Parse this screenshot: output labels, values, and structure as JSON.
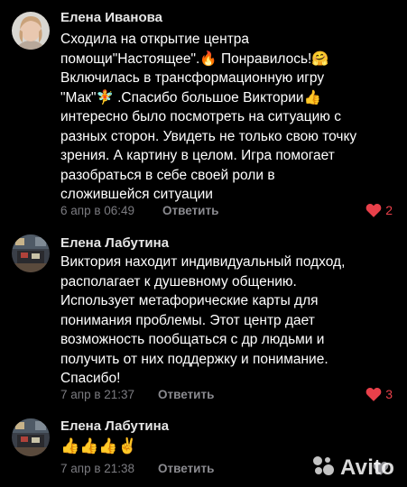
{
  "comments": [
    {
      "author": "Елена Иванова",
      "text": "Сходила на открытие центра\nпомощи\"Настоящее\".🔥 Понравилось!🤗\nВключилась в трансформационную игру\n\"Мак\"🧚 .Спасибо большое Виктории👍\nинтересно было посмотреть на ситуацию с\nразных сторон. Увидеть не только свою точку\nзрения. А картину в целом. Игра помогает\nразобраться в себе своей роли в\nсложившейся ситуации",
      "timestamp": "6 апр в 06:49",
      "reply_label": "Ответить",
      "likes": "2",
      "avatar_icon": "woman-portrait-avatar"
    },
    {
      "author": "Елена Лабутина",
      "text": "Виктория находит индивидуальный подход,\nрасполагает к душевному общению.\nИспользует метафорические карты для\nпонимания проблемы. Этот центр дает\nвозможность пообщаться с др людьми и\nполучить от них поддержку и понимание.\nСпасибо!",
      "timestamp": "7 апр в 21:37",
      "reply_label": "Ответить",
      "likes": "3",
      "avatar_icon": "room-photo-avatar"
    },
    {
      "author": "Елена Лабутина",
      "text": "👍👍👍✌️",
      "timestamp": "7 апр в 21:38",
      "reply_label": "Ответить",
      "likes": "",
      "avatar_icon": "room-photo-avatar"
    }
  ],
  "watermark": {
    "text": "Avito",
    "icon": "avito-dots-icon"
  },
  "colors": {
    "background": "#000000",
    "author": "#e6e6e6",
    "meta": "#7b7b80",
    "like": "#e8404a"
  }
}
